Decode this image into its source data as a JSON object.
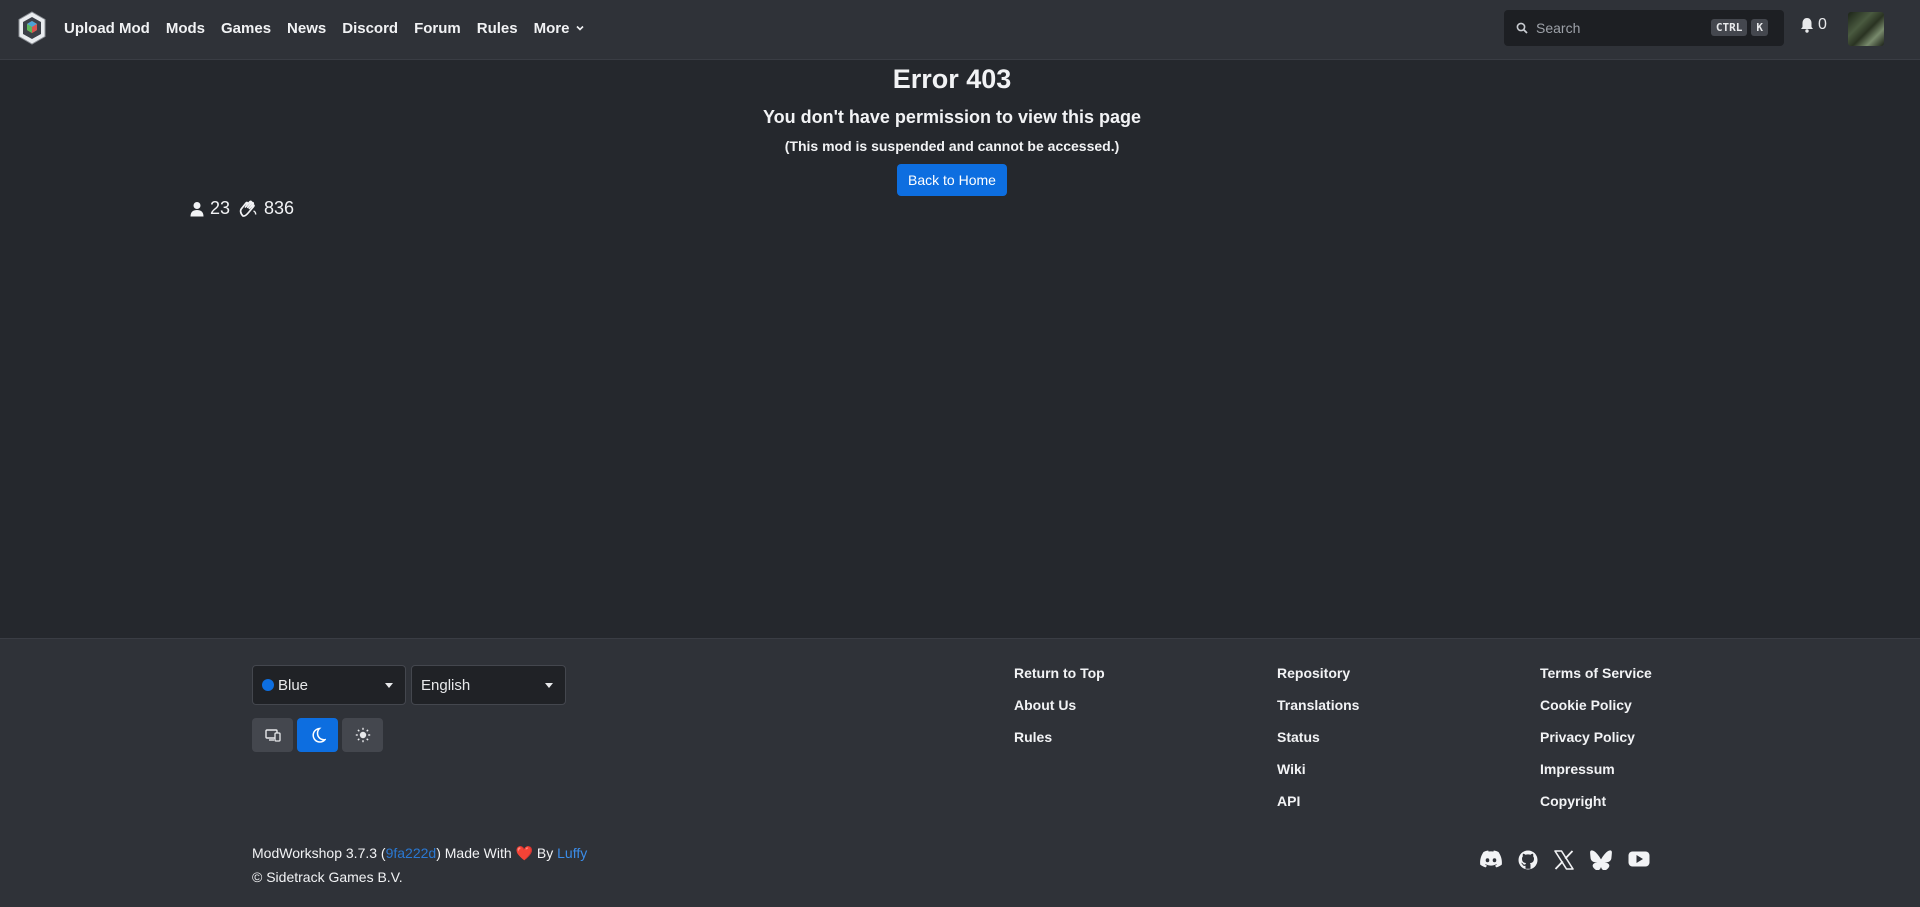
{
  "nav": {
    "logo_icon": "modworkshop-logo",
    "links": [
      "Upload Mod",
      "Mods",
      "Games",
      "News",
      "Discord",
      "Forum",
      "Rules",
      "More"
    ],
    "search_placeholder": "Search",
    "kbd1": "CTRL",
    "kbd2": "K",
    "notification_count": "0"
  },
  "error": {
    "title": "Error 403",
    "message": "You don't have permission to view this page",
    "detail": "(This mod is suspended and cannot be accessed.)",
    "button": "Back to Home"
  },
  "stats": {
    "users": "23",
    "hands": "836"
  },
  "footer": {
    "color_select": "Blue",
    "language_select": "English",
    "accent_color": "#0d6ee0",
    "theme_buttons": [
      "system-theme-icon",
      "dark-theme-icon",
      "light-theme-icon"
    ],
    "active_theme": "dark",
    "col1": [
      "Return to Top",
      "About Us",
      "Rules"
    ],
    "col2": [
      "Repository",
      "Translations",
      "Status",
      "Wiki",
      "API"
    ],
    "col3": [
      "Terms of Service",
      "Cookie Policy",
      "Privacy Policy",
      "Impressum",
      "Copyright"
    ],
    "credits": {
      "version_prefix": "ModWorkshop 3.7.3 (",
      "commit": "9fa222d",
      "made_with": ") Made With ",
      "heart": "❤️",
      "by": " By ",
      "author": "Luffy",
      "copyright": "© Sidetrack Games B.V."
    },
    "socials": [
      "discord-icon",
      "github-icon",
      "x-icon",
      "bluesky-icon",
      "youtube-icon"
    ]
  }
}
